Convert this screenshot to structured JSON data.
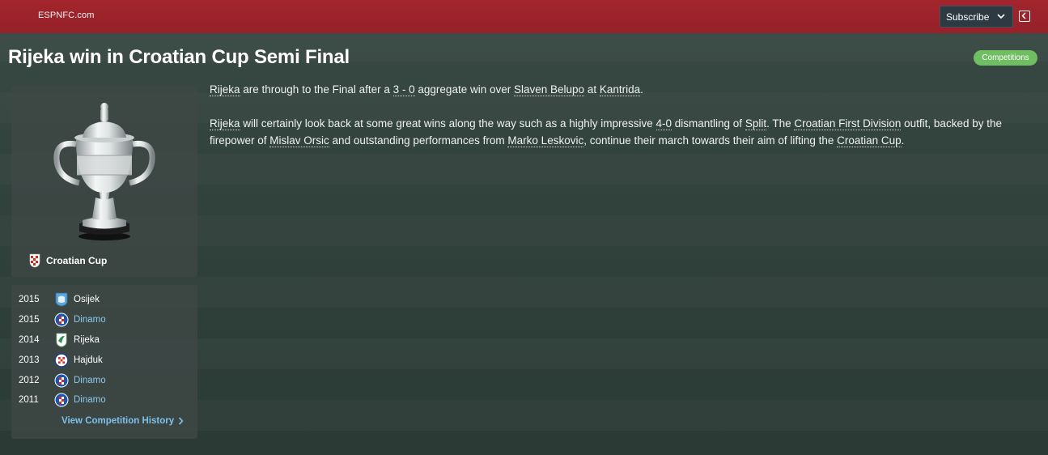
{
  "header": {
    "brand": "ESPNFC.com",
    "subscribe_label": "Subscribe"
  },
  "headline": "Rijeka win in Croatian Cup Semi Final",
  "category_tag": "Competitions",
  "competition": {
    "name": "Croatian Cup",
    "flag_icon": "croatia-flag-icon",
    "trophy_icon": "trophy-icon"
  },
  "history": {
    "rows": [
      {
        "year": "2015",
        "team": "Osijek",
        "badge": "osijek-badge-icon"
      },
      {
        "year": "2015",
        "team": "Dinamo",
        "badge": "dinamo-badge-icon"
      },
      {
        "year": "2014",
        "team": "Rijeka",
        "badge": "rijeka-badge-icon"
      },
      {
        "year": "2013",
        "team": "Hajduk",
        "badge": "hajduk-badge-icon"
      },
      {
        "year": "2012",
        "team": "Dinamo",
        "badge": "dinamo-badge-icon"
      },
      {
        "year": "2011",
        "team": "Dinamo",
        "badge": "dinamo-badge-icon"
      }
    ],
    "link_label": "View Competition History"
  },
  "article": {
    "p1": {
      "team": "Rijeka",
      "t1": " are through to the Final after a ",
      "score": "3 - 0",
      "t2": " aggregate win over ",
      "opponent": "Slaven Belupo",
      "t3": " at ",
      "venue": "Kantrida",
      "t4": "."
    },
    "p2": {
      "team": "Rijeka",
      "t1": " will certainly look back at some great wins along the way such as a highly impressive ",
      "score": "4-0",
      "t2": " dismantling of ",
      "opponent": "Split",
      "t3": ". The ",
      "league": "Croatian First Division",
      "t4": " outfit, backed by the firepower of ",
      "player1": "Mislav Orsic",
      "t5": " and outstanding performances from ",
      "player2": "Marko Leskovic",
      "t6": ", continue their march towards their aim of lifting the ",
      "cup": "Croatian Cup",
      "t7": "."
    }
  },
  "colors": {
    "topbar": "#a3242c",
    "tag": "#6fbe62",
    "link": "#8ec7ee"
  }
}
